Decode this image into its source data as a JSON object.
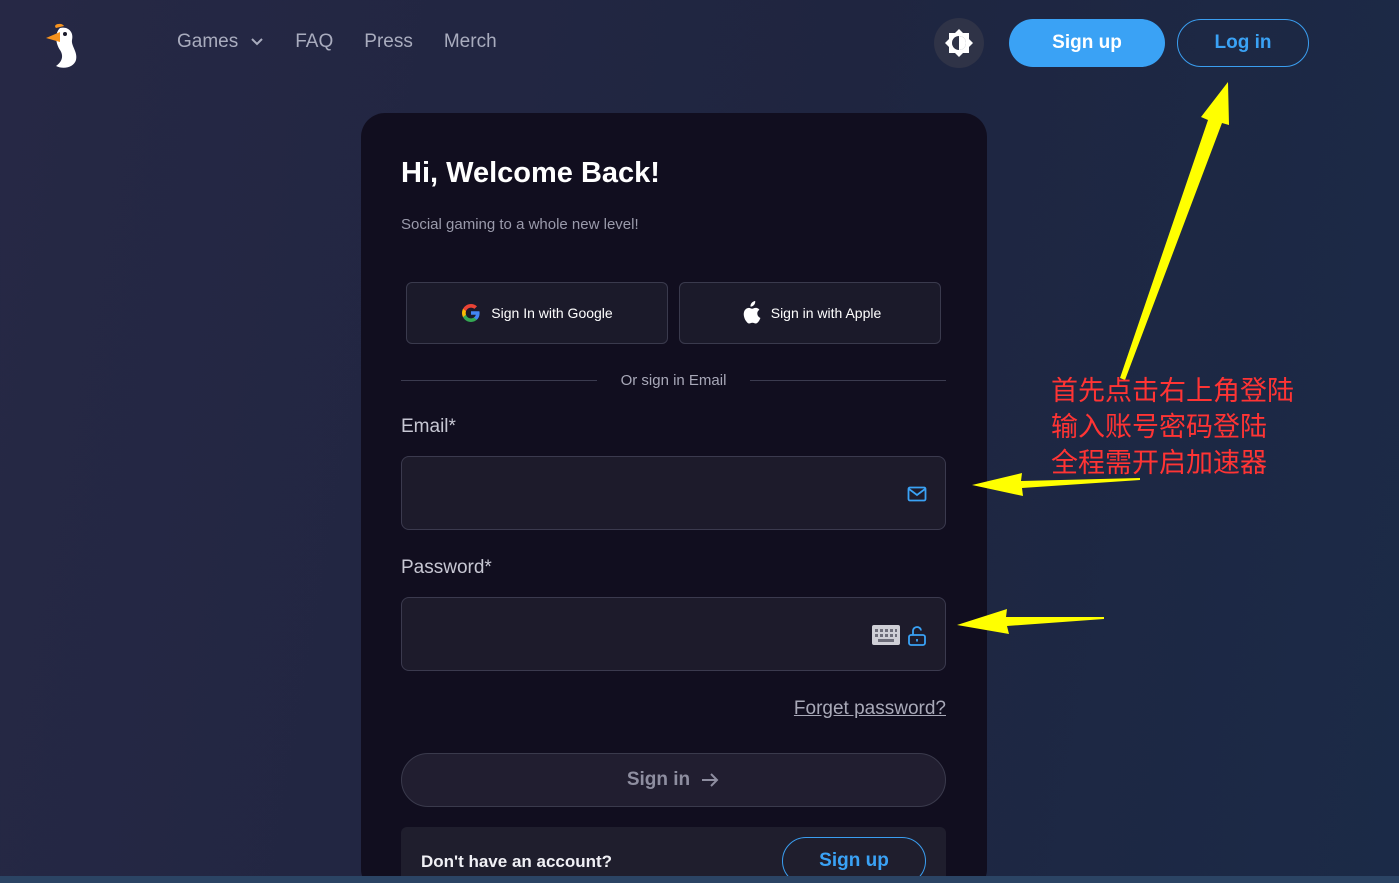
{
  "header": {
    "logo_icon": "goose-logo-icon",
    "nav": [
      {
        "label": "Games",
        "has_dropdown": true
      },
      {
        "label": "FAQ"
      },
      {
        "label": "Press"
      },
      {
        "label": "Merch"
      }
    ],
    "theme_icon": "theme-toggle-icon",
    "signup_label": "Sign up",
    "login_label": "Log in"
  },
  "card": {
    "title": "Hi, Welcome Back!",
    "subtitle": "Social gaming to a whole new level!",
    "google_label": "Sign In with Google",
    "apple_label": "Sign in with Apple",
    "divider_text": "Or sign in Email",
    "email_label": "Email*",
    "email_value": "",
    "password_label": "Password*",
    "password_value": "",
    "forgot_label": "Forget password?",
    "signin_label": "Sign in",
    "no_account_text": "Don't have an account?",
    "signup_label": "Sign up"
  },
  "annotation": {
    "lines": [
      "首先点击右上角登陆",
      "输入账号密码登陆",
      "全程需开启加速器"
    ],
    "color": "#ff3434",
    "arrow_color": "#ffff00"
  },
  "colors": {
    "accent": "#3aa2f5",
    "card_bg": "#110e1f",
    "page_bg": "#232641"
  }
}
